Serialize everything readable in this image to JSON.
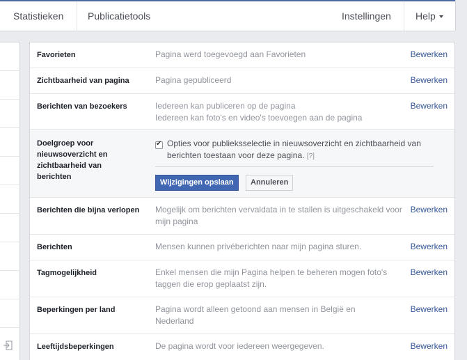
{
  "nav": {
    "stats": "Statistieken",
    "tools": "Publicatietools",
    "settings": "Instellingen",
    "help": "Help"
  },
  "settings": {
    "edit_label": "Bewerken",
    "rows": [
      {
        "label": "Favorieten",
        "value": "Pagina werd toegevoegd aan Favorieten"
      },
      {
        "label": "Zichtbaarheid van pagina",
        "value": "Pagina gepubliceerd"
      },
      {
        "label": "Berichten van bezoekers",
        "value": "Iedereen kan publiceren op de pagina\nIedereen kan foto's en video's toevoegen aan de pagina"
      },
      {
        "label": "Berichten die bijna verlopen",
        "value": "Mogelijk om berichten vervaldata in te stallen is uitgeschakeld voor mijn pagina"
      },
      {
        "label": "Berichten",
        "value": "Mensen kunnen privéberichten naar mijn pagina sturen."
      },
      {
        "label": "Tagmogelijkheid",
        "value": "Enkel mensen die mijn Pagina helpen te beheren mogen foto's taggen die erop geplaatst zijn."
      },
      {
        "label": "Beperkingen per land",
        "value": "Pagina wordt alleen getoond aan mensen in België en Nederland"
      },
      {
        "label": "Leeftijdsbeperkingen",
        "value": "De pagina wordt voor iedereen weergegeven."
      }
    ],
    "expanded": {
      "label": "Doelgroep voor nieuwsoverzicht en zichtbaarheid van berichten",
      "checkbox_text": "Opties voor publieksselectie in nieuwsoverzicht en zichtbaarheid van berichten toestaan voor deze pagina.",
      "help_mark": "[?]",
      "checked": true,
      "save_label": "Wijzigingen opslaan",
      "cancel_label": "Annuleren"
    }
  }
}
